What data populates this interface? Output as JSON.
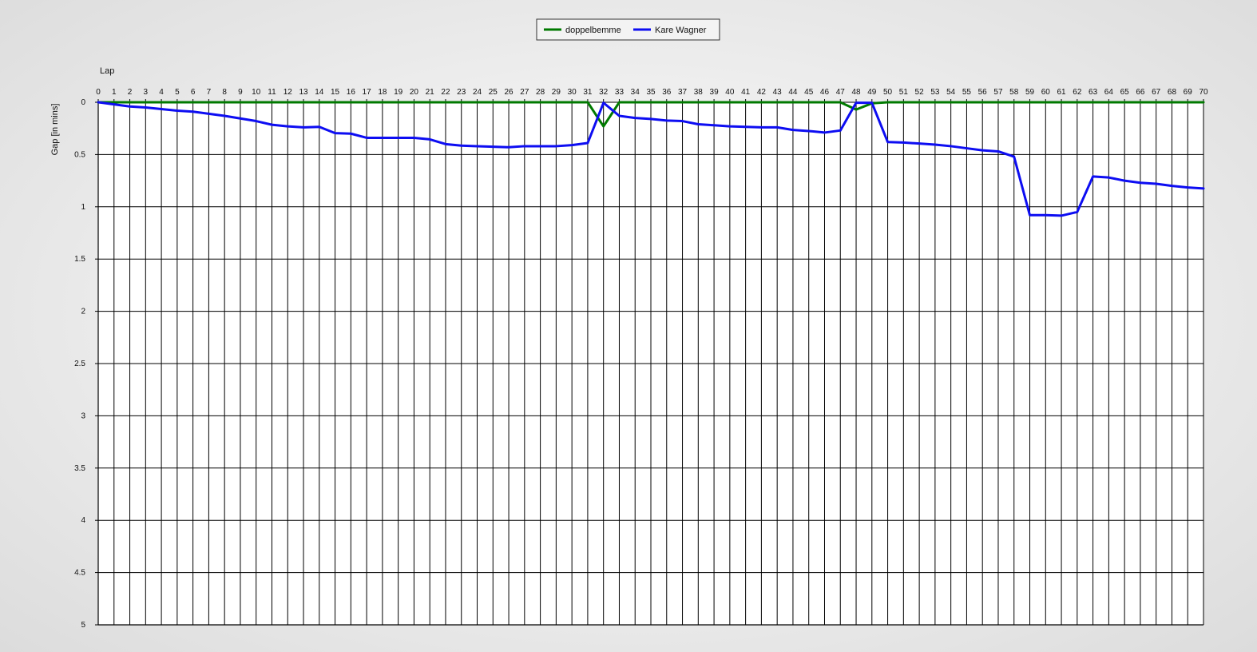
{
  "chart_data": {
    "type": "line",
    "xlabel": "Lap",
    "ylabel": "Gap [in mins]",
    "x": [
      0,
      1,
      2,
      3,
      4,
      5,
      6,
      7,
      8,
      9,
      10,
      11,
      12,
      13,
      14,
      15,
      16,
      17,
      18,
      19,
      20,
      21,
      22,
      23,
      24,
      25,
      26,
      27,
      28,
      29,
      30,
      31,
      32,
      33,
      34,
      35,
      36,
      37,
      38,
      39,
      40,
      41,
      42,
      43,
      44,
      45,
      46,
      47,
      48,
      49,
      50,
      51,
      52,
      53,
      54,
      55,
      56,
      57,
      58,
      59,
      60,
      61,
      62,
      63,
      64,
      65,
      66,
      67,
      68,
      69,
      70
    ],
    "xlim": [
      0,
      70
    ],
    "ylim": [
      0,
      5
    ],
    "y_inverted": true,
    "x_axis_position": "top",
    "yticks": [
      "0",
      "0.5",
      "1",
      "1.5",
      "2",
      "2.5",
      "3",
      "3.5",
      "4",
      "4.5",
      "5"
    ],
    "grid": true,
    "legend_position": "top-center",
    "series": [
      {
        "name": "doppelbemme",
        "color": "#007a00",
        "values": [
          0,
          0,
          0,
          0,
          0,
          0,
          0,
          0,
          0,
          0,
          0,
          0,
          0,
          0,
          0,
          0,
          0,
          0,
          0,
          0,
          0,
          0,
          0,
          0,
          0,
          0,
          0,
          0,
          0,
          0,
          0,
          0,
          0.23,
          0,
          0,
          0,
          0,
          0,
          0,
          0,
          0,
          0,
          0,
          0,
          0,
          0,
          0,
          0,
          0.07,
          0.01,
          0,
          0,
          0,
          0,
          0,
          0,
          0,
          0,
          0,
          0,
          0,
          0,
          0,
          0,
          0,
          0,
          0,
          0,
          0,
          0,
          0
        ]
      },
      {
        "name": "Kare Wagner",
        "color": "#0d0df2",
        "values": [
          0,
          0.02,
          0.04,
          0.05,
          0.065,
          0.08,
          0.09,
          0.11,
          0.13,
          0.155,
          0.18,
          0.215,
          0.23,
          0.24,
          0.235,
          0.295,
          0.3,
          0.34,
          0.34,
          0.34,
          0.34,
          0.355,
          0.4,
          0.415,
          0.42,
          0.425,
          0.43,
          0.42,
          0.42,
          0.42,
          0.41,
          0.39,
          0.005,
          0.13,
          0.15,
          0.16,
          0.175,
          0.18,
          0.21,
          0.22,
          0.23,
          0.235,
          0.24,
          0.24,
          0.265,
          0.275,
          0.29,
          0.27,
          0.005,
          0.005,
          0.38,
          0.385,
          0.395,
          0.405,
          0.42,
          0.44,
          0.46,
          0.47,
          0.52,
          1.08,
          1.08,
          1.085,
          1.05,
          0.71,
          0.72,
          0.75,
          0.77,
          0.78,
          0.8,
          0.815,
          0.825
        ]
      }
    ]
  }
}
